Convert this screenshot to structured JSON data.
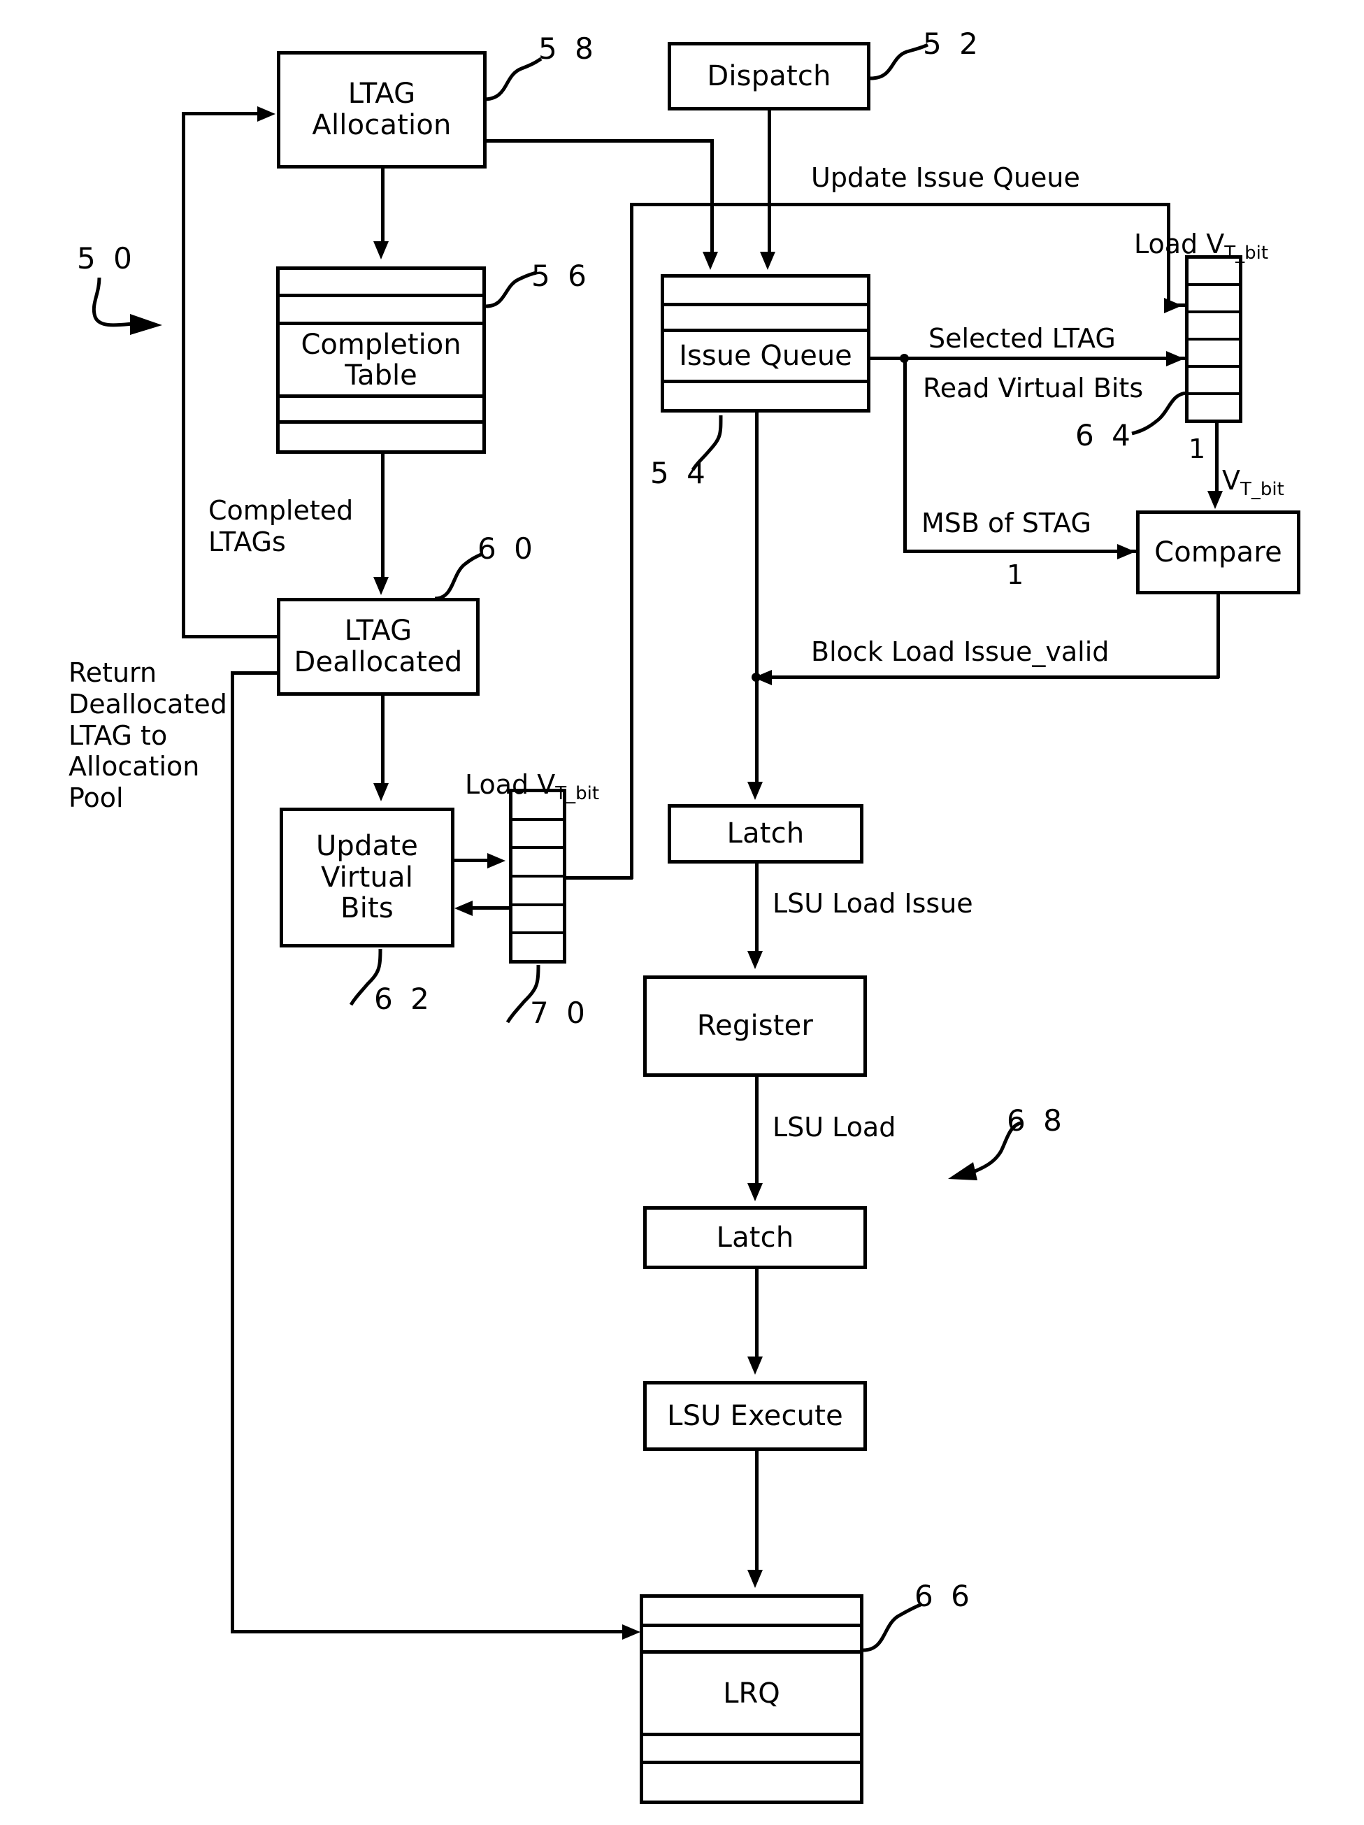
{
  "figure": {
    "type": "patent-block-diagram",
    "overall_ref": "5 0"
  },
  "blocks": [
    {
      "id": "ltag_allocation",
      "label": "LTAG\nAllocation",
      "ref": "5 8"
    },
    {
      "id": "dispatch",
      "label": "Dispatch",
      "ref": "5 2"
    },
    {
      "id": "completion_table",
      "label": "Completion\nTable",
      "ref": "5 6"
    },
    {
      "id": "issue_queue",
      "label": "Issue Queue",
      "ref": "5 4"
    },
    {
      "id": "ltag_deallocated",
      "label": "LTAG\nDeallocated",
      "ref": "6 0"
    },
    {
      "id": "update_virtual_bits",
      "label": "Update\nVirtual\nBits",
      "ref": "6 2"
    },
    {
      "id": "compare",
      "label": "Compare",
      "ref": ""
    },
    {
      "id": "latch_1",
      "label": "Latch",
      "ref": ""
    },
    {
      "id": "register",
      "label": "Register",
      "ref": ""
    },
    {
      "id": "latch_2",
      "label": "Latch",
      "ref": ""
    },
    {
      "id": "lsu_execute",
      "label": "LSU Execute",
      "ref": ""
    },
    {
      "id": "lrq",
      "label": "LRQ",
      "ref": "6 6"
    }
  ],
  "register_files": [
    {
      "id": "virtual_bits_64",
      "ref": "6 4",
      "cells": 6,
      "label_above": "Load V",
      "label_above_sub": "T_bit",
      "out_width": "1",
      "out_signal": "V",
      "out_signal_sub": "T_bit"
    },
    {
      "id": "virtual_bits_70",
      "ref": "7 0",
      "cells": 6,
      "label_above": "Load V",
      "label_above_sub": "T_bit"
    }
  ],
  "edge_labels": {
    "update_issue_queue": "Update Issue Queue",
    "load_vt_bit_top": "Load V",
    "load_vt_bit_top_sub": "T_bit",
    "selected_ltag": "Selected LTAG",
    "read_virtual_bits": "Read Virtual Bits",
    "msb_of_stag": "MSB of STAG",
    "msb_width": "1",
    "vt_bit_width": "1",
    "vt_bit_signal": "V",
    "vt_bit_signal_sub": "T_bit",
    "block_load_issue_valid": "Block Load Issue_valid",
    "completed_ltags": "Completed\nLTAGs",
    "return_pool": "Return\nDeallocated\nLTAG to\nAllocation\nPool",
    "load_vt_bit_mid": "Load V",
    "load_vt_bit_mid_sub": "T_bit",
    "lsu_load_issue": "LSU Load Issue",
    "lsu_load": "LSU Load",
    "pipeline_ref": "6 8"
  },
  "refs": {
    "r50": "5 0",
    "r52": "5 2",
    "r54": "5 4",
    "r56": "5 6",
    "r58": "5 8",
    "r60": "6 0",
    "r62": "6 2",
    "r64": "6 4",
    "r66": "6 6",
    "r68": "6 8",
    "r70": "7 0"
  },
  "colors": {
    "ink": "#000000",
    "paper": "#ffffff"
  }
}
